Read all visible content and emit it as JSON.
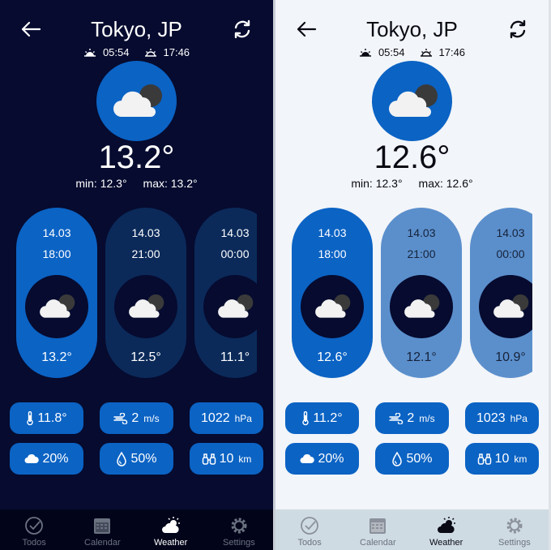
{
  "colors": {
    "dark_bg": "#060b2f",
    "light_bg": "#f2f5f9",
    "accent": "#0b63c4",
    "card_dim_dark": "#0b2a5a",
    "card_dim_light": "#5b8fcc"
  },
  "dark": {
    "city": "Tokyo, JP",
    "sunrise": "05:54",
    "sunset": "17:46",
    "temp": "13.2°",
    "min": "min: 12.3°",
    "max": "max: 13.2°",
    "forecast": [
      {
        "date": "14.03",
        "time": "18:00",
        "temp": "13.2°",
        "icon": "cloud-moon-icon"
      },
      {
        "date": "14.03",
        "time": "21:00",
        "temp": "12.5°",
        "icon": "cloud-moon-icon"
      },
      {
        "date": "14.03",
        "time": "00:00",
        "temp": "11.1°",
        "icon": "cloud-moon-icon"
      }
    ],
    "feels_like": "11.8°",
    "wind": "2",
    "wind_unit": "m/s",
    "pressure": "1022",
    "pressure_unit": "hPa",
    "clouds": "20%",
    "humidity": "50%",
    "visibility": "10",
    "visibility_unit": "km"
  },
  "light": {
    "city": "Tokyo, JP",
    "sunrise": "05:54",
    "sunset": "17:46",
    "temp": "12.6°",
    "min": "min: 12.3°",
    "max": "max: 12.6°",
    "forecast": [
      {
        "date": "14.03",
        "time": "18:00",
        "temp": "12.6°",
        "icon": "cloud-moon-icon"
      },
      {
        "date": "14.03",
        "time": "21:00",
        "temp": "12.1°",
        "icon": "cloud-moon-icon"
      },
      {
        "date": "14.03",
        "time": "00:00",
        "temp": "10.9°",
        "icon": "cloud-moon-icon"
      }
    ],
    "feels_like": "11.2°",
    "wind": "2",
    "wind_unit": "m/s",
    "pressure": "1023",
    "pressure_unit": "hPa",
    "clouds": "20%",
    "humidity": "50%",
    "visibility": "10",
    "visibility_unit": "km"
  },
  "nav": {
    "todos": "Todos",
    "calendar": "Calendar",
    "weather": "Weather",
    "settings": "Settings",
    "active": "Weather"
  }
}
